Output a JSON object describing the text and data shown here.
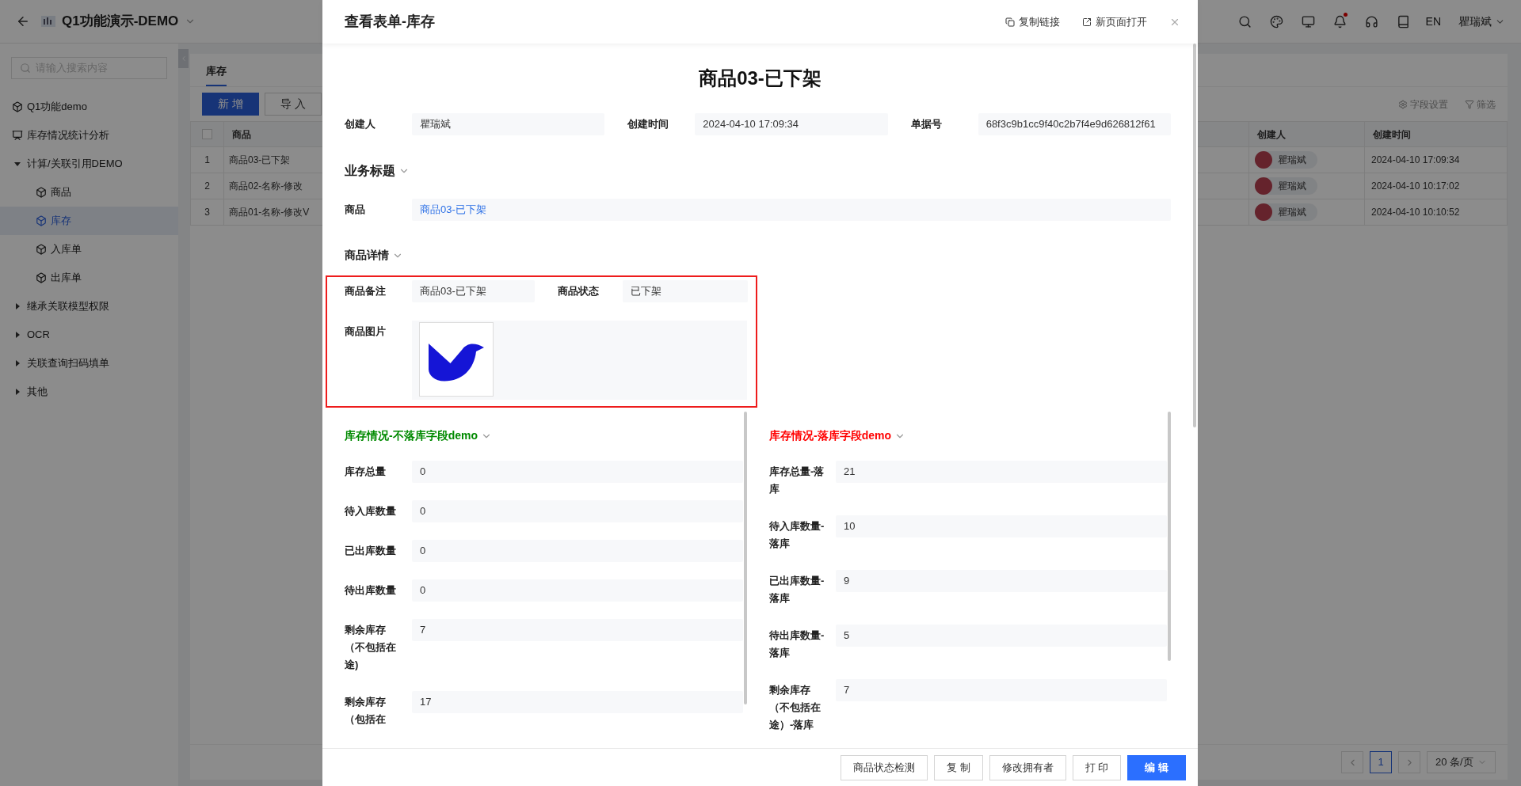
{
  "app_header": {
    "title": "Q1功能演示-DEMO",
    "language": "EN",
    "user": "瞿瑞斌",
    "icons": [
      {
        "kind": "search",
        "badge": false
      },
      {
        "kind": "palette",
        "badge": false
      },
      {
        "kind": "monitor",
        "badge": false
      },
      {
        "kind": "bell",
        "badge": true
      },
      {
        "kind": "headset",
        "badge": false
      },
      {
        "kind": "book",
        "badge": false
      }
    ]
  },
  "sidebar": {
    "search": {
      "placeholder": "请输入搜索内容"
    },
    "items": [
      {
        "label": "Q1功能demo",
        "kind": "cube",
        "selected": false
      },
      {
        "label": "库存情况统计分析",
        "kind": "chart",
        "selected": false
      },
      {
        "label": "计算/关联引用DEMO",
        "kind": "folder",
        "expanded": true,
        "selected": false,
        "children": [
          {
            "label": "商品",
            "kind": "cube",
            "selected": false
          },
          {
            "label": "库存",
            "kind": "cube",
            "selected": true
          },
          {
            "label": "入库单",
            "kind": "cube",
            "selected": false
          },
          {
            "label": "出库单",
            "kind": "cube",
            "selected": false
          }
        ]
      },
      {
        "label": "继承关联模型权限",
        "kind": "folder",
        "expanded": false,
        "selected": false
      },
      {
        "label": "OCR",
        "kind": "folder",
        "expanded": false,
        "selected": false
      },
      {
        "label": "关联查询扫码填单",
        "kind": "folder",
        "expanded": false,
        "selected": false
      },
      {
        "label": "其他",
        "kind": "folder",
        "expanded": false,
        "selected": false
      }
    ]
  },
  "content": {
    "tabs": [
      {
        "label": "库存",
        "selected": true
      }
    ],
    "buttons": [
      {
        "label": "新 增",
        "kind": "primary"
      },
      {
        "label": "导 入",
        "kind": "default"
      }
    ],
    "tools": [
      {
        "label": "字段设置",
        "kind": "settings"
      },
      {
        "label": "筛选",
        "kind": "filter"
      }
    ],
    "table": {
      "select_all_checked": false,
      "columns": [
        "商品",
        "创建人",
        "创建时间"
      ],
      "rows": [
        {
          "index": "1",
          "product": "商品03-已下架",
          "creator": "瞿瑞斌",
          "created": "2024-04-10 17:09:34"
        },
        {
          "index": "2",
          "product": "商品02-名称-修改",
          "creator": "瞿瑞斌",
          "created": "2024-04-10 10:17:02"
        },
        {
          "index": "3",
          "product": "商品01-名称-修改V",
          "creator": "瞿瑞斌",
          "created": "2024-04-10 10:10:52"
        }
      ]
    },
    "pagination": {
      "pages": [
        {
          "label": "1",
          "selected": true
        }
      ],
      "page_size": "20 条/页"
    }
  },
  "modal": {
    "title": "查看表单-库存",
    "actions": [
      {
        "label": "复制链接",
        "kind": "copy"
      },
      {
        "label": "新页面打开",
        "kind": "open"
      }
    ],
    "record_title": "商品03-已下架",
    "meta": [
      {
        "label": "创建人",
        "value": "瞿瑞斌"
      },
      {
        "label": "创建时间",
        "value": "2024-04-10 17:09:34"
      },
      {
        "label": "单据号",
        "value": "68f3c9b1cc9f40c2b7f4e9d626812f61"
      }
    ],
    "sections": [
      {
        "title": "业务标题",
        "highlighted": false,
        "fields": [
          {
            "label": "商品",
            "value": "商品03-已下架",
            "kind": "link"
          }
        ]
      },
      {
        "title": "商品详情",
        "highlighted": true,
        "fields": [
          {
            "label": "商品备注",
            "value": "商品03-已下架",
            "kind": "text"
          },
          {
            "label": "商品状态",
            "value": "已下架",
            "kind": "text"
          },
          {
            "label": "商品图片"
          }
        ]
      }
    ],
    "columns": [
      {
        "title": "库存情况-不落库字段demo",
        "color": "#008a00",
        "fields": [
          {
            "label": "库存总量",
            "value": "0"
          },
          {
            "label": "待入库数量",
            "value": "0"
          },
          {
            "label": "已出库数量",
            "value": "0"
          },
          {
            "label": "待出库数量",
            "value": "0"
          },
          {
            "label": "剩余库存（不包括在途)",
            "value": "7"
          },
          {
            "label": "剩余库存（包括在",
            "value": "17"
          }
        ]
      },
      {
        "title": "库存情况-落库字段demo",
        "color": "#ff0000",
        "fields": [
          {
            "label": "库存总量-落库",
            "value": "21"
          },
          {
            "label": "待入库数量-落库",
            "value": "10"
          },
          {
            "label": "已出库数量-落库",
            "value": "9"
          },
          {
            "label": "待出库数量-落库",
            "value": "5"
          },
          {
            "label": "剩余库存（不包括在途）-落库",
            "value": "7"
          }
        ]
      }
    ],
    "footer_buttons": [
      {
        "label": "商品状态检测",
        "kind": "default"
      },
      {
        "label": "复 制",
        "kind": "default"
      },
      {
        "label": "修改拥有者",
        "kind": "default"
      },
      {
        "label": "打 印",
        "kind": "default"
      },
      {
        "label": "编 辑",
        "kind": "primary"
      }
    ]
  }
}
